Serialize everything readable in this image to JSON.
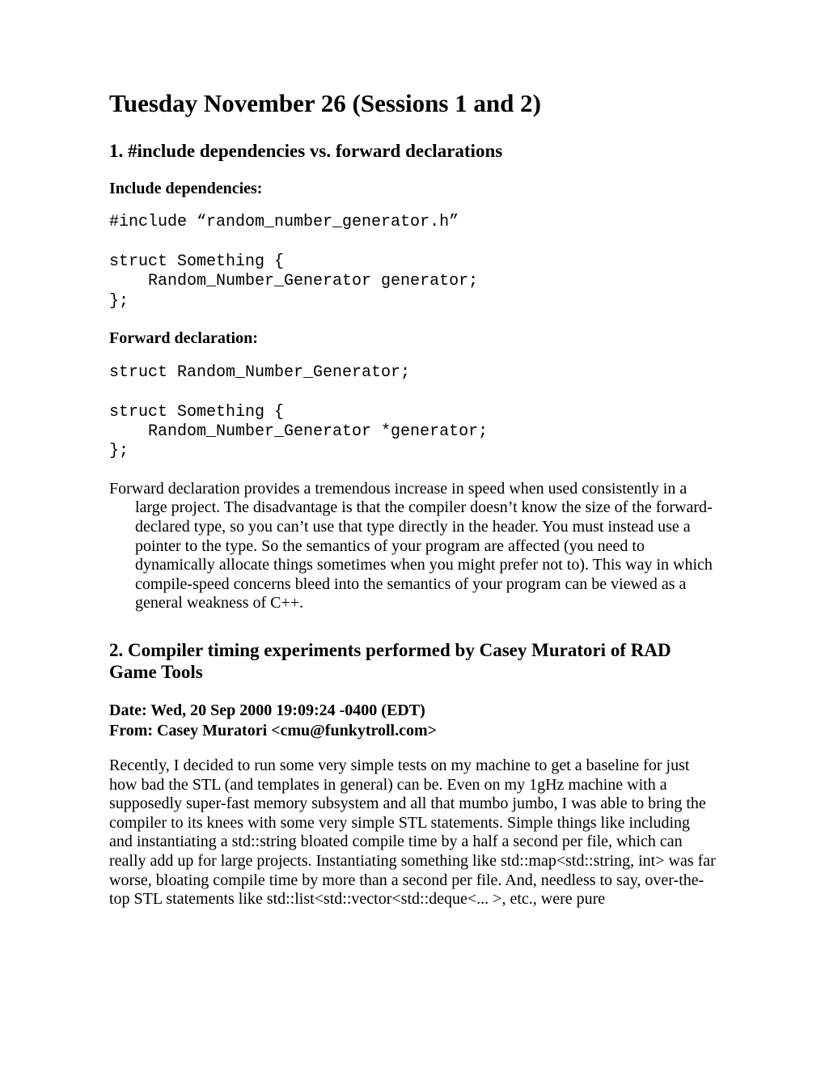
{
  "title": "Tuesday November 26 (Sessions 1 and 2)",
  "section1": {
    "heading": "1. #include dependencies vs. forward declarations",
    "sub1": "Include dependencies:",
    "code1": "#include “random_number_generator.h”\n\nstruct Something {\n    Random_Number_Generator generator;\n};",
    "sub2": "Forward declaration:",
    "code2": "struct Random_Number_Generator;\n\nstruct Something {\n    Random_Number_Generator *generator;\n};",
    "para": "Forward declaration provides a tremendous increase in speed when used consistently in a large project.  The disadvantage is that the compiler doesn’t know the size of the forward-declared type, so you can’t use that type directly in the header.  You must instead use a pointer to the type.  So the semantics of your program are affected (you need to dynamically allocate things sometimes when you might prefer not to).  This way in which compile-speed concerns bleed into the semantics of your program can be viewed as a general weakness of C++."
  },
  "section2": {
    "heading": "2. Compiler timing experiments performed by Casey Muratori of RAD Game Tools",
    "date": "Date: Wed, 20 Sep 2000 19:09:24 -0400 (EDT)",
    "from": "From: Casey Muratori <cmu@funkytroll.com>",
    "para": "Recently, I decided to run some very simple tests on my machine to get a baseline for just how bad the STL (and templates in general) can be.  Even on my 1gHz machine with a supposedly super-fast memory subsystem and all that mumbo jumbo, I was able to bring the compiler to its knees with some very simple STL statements.  Simple things like including and instantiating a std::string bloated compile time by a half a second per file, which can really add up for large projects.  Instantiating something like std::map<std::string, int> was far worse, bloating compile time by more than a second per file.  And, needless to say, over-the-top STL statements like std::list<std::vector<std::deque<... >, etc., were pure"
  }
}
